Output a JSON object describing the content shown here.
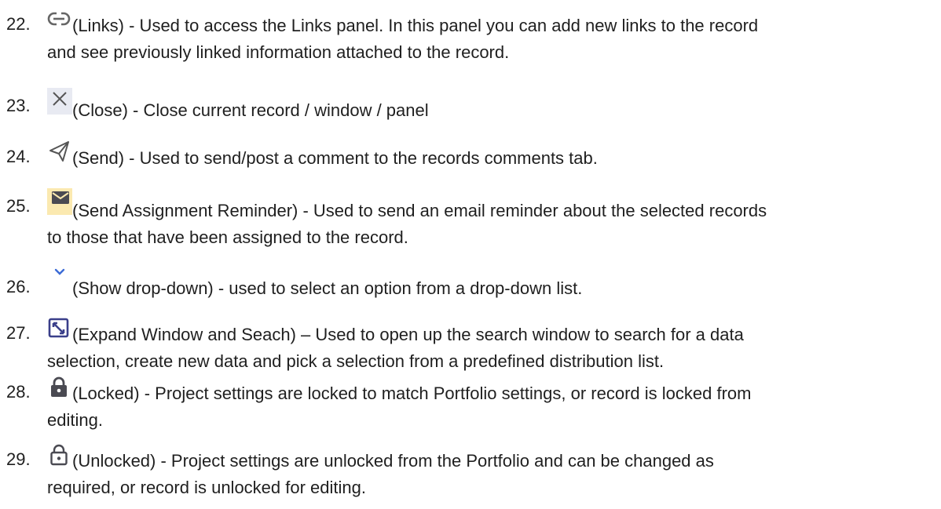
{
  "items": [
    {
      "number": "22.",
      "icon": "link-icon",
      "text_line1": "(Links) - Used to access the Links panel. In this panel you can add new links to the record",
      "text_line2": "and see previously linked information attached to the record."
    },
    {
      "number": "23.",
      "icon": "close-icon",
      "text_line1": "(Close) - Close current record / window / panel"
    },
    {
      "number": "24.",
      "icon": "send-icon",
      "text_line1": "(Send) - Used to send/post a comment to the records comments tab."
    },
    {
      "number": "25.",
      "icon": "envelope-icon",
      "text_line1": "(Send Assignment Reminder) - Used to send an email reminder about the selected records",
      "text_line2": "to those that have been assigned to the record."
    },
    {
      "number": "26.",
      "icon": "chevron-down-icon",
      "text_line1": "(Show drop-down) - used to select an option from a drop-down list."
    },
    {
      "number": "27.",
      "icon": "expand-window-icon",
      "text_line1": "(Expand Window and Seach) – Used to open up the search window to search for a data",
      "text_line2": "selection, create new data and pick a selection from a predefined distribution list."
    },
    {
      "number": "28.",
      "icon": "lock-icon",
      "text_line1": "(Locked) - Project settings are locked to match Portfolio settings, or record is locked from",
      "text_line2": "editing."
    },
    {
      "number": "29.",
      "icon": "unlock-icon",
      "text_line1": "(Unlocked) - Project settings are unlocked from the Portfolio and can be changed as",
      "text_line2": "required, or record is unlocked for editing."
    }
  ],
  "colors": {
    "text": "#1f1f1f",
    "icon_gray": "#6b6b6b",
    "icon_blue": "#3c6bd6",
    "icon_dark": "#4a4a52",
    "highlight_box": "#e8eaf2",
    "highlight_yellow": "#fbe9b0"
  }
}
